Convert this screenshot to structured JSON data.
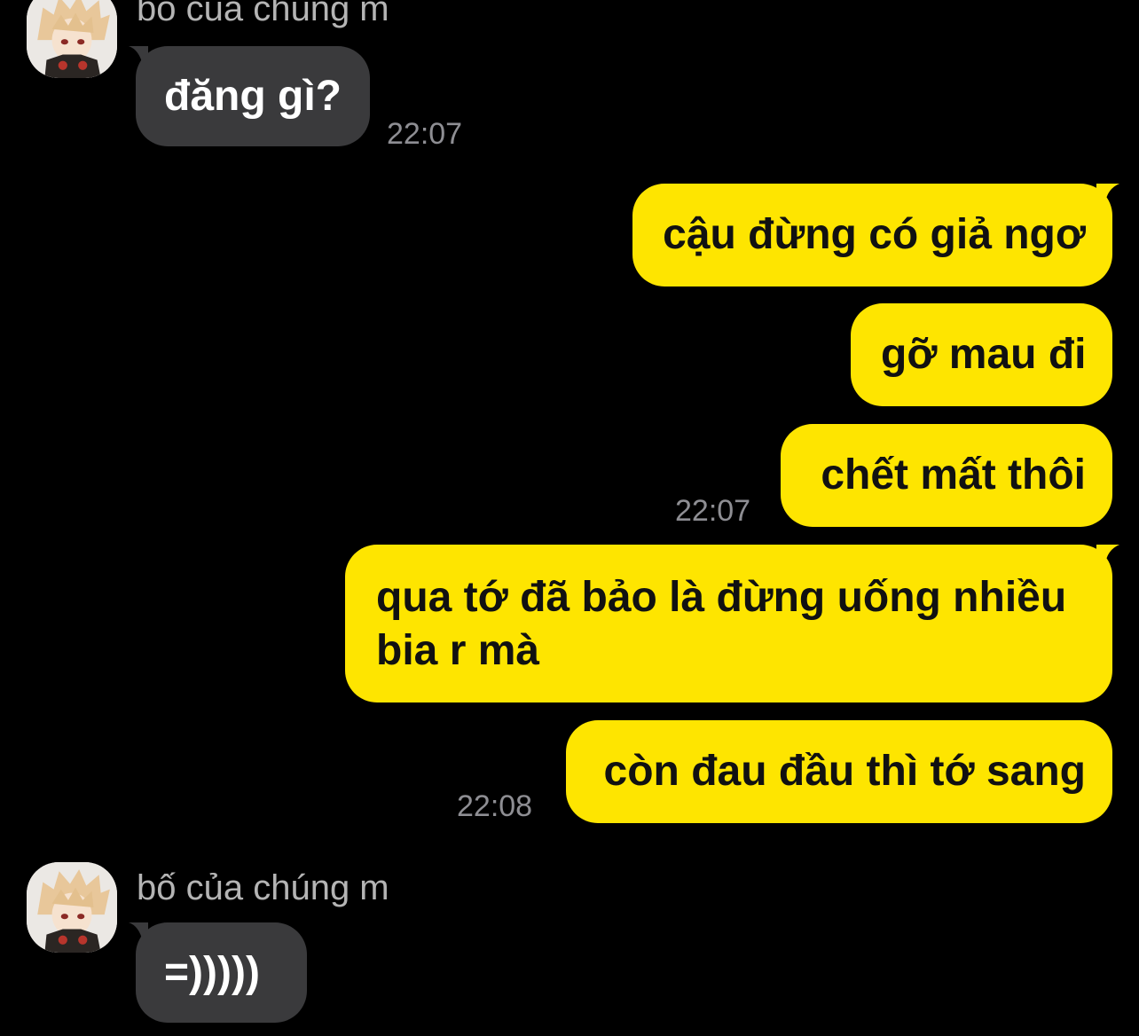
{
  "conversation": {
    "messages": [
      {
        "direction": "in",
        "sender": "bố của chúng m",
        "avatar": "avatar-icon",
        "text": "đăng gì?",
        "time": "22:07"
      },
      {
        "direction": "out",
        "text": "cậu đừng có giả ngơ"
      },
      {
        "direction": "out",
        "text": "gỡ mau đi"
      },
      {
        "direction": "out",
        "text": "chết mất thôi",
        "time": "22:07"
      },
      {
        "direction": "out",
        "text": "qua tớ đã bảo là đừng uống nhiều bia r mà"
      },
      {
        "direction": "out",
        "text": "còn đau đầu thì tớ sang",
        "time": "22:08"
      },
      {
        "direction": "in",
        "sender": "bố của chúng m",
        "avatar": "avatar-icon",
        "text": "=)))))"
      }
    ]
  },
  "colors": {
    "background": "#000000",
    "incoming_bubble": "#3a3a3c",
    "outgoing_bubble": "#fee500",
    "timestamp": "#8e8e93",
    "sender_name": "#b4b4b4"
  }
}
